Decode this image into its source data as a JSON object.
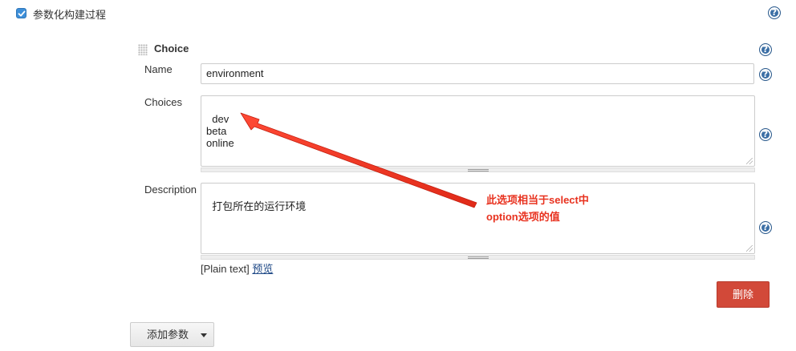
{
  "header": {
    "checkbox_checked": true,
    "checkbox_label": "参数化构建过程"
  },
  "parameter": {
    "title": "Choice",
    "name_label": "Name",
    "name_value": "environment",
    "choices_label": "Choices",
    "choices_value": "dev\nbeta\nonline",
    "description_label": "Description",
    "description_value": "打包所在的运行环境",
    "plain_text_label": "[Plain text]",
    "preview_link": "预览",
    "delete_button": "删除"
  },
  "add_param_button": "添加参数",
  "annotation": {
    "line1": "此选项相当于select中",
    "line2": "option选项的值",
    "color": "#e8321f"
  },
  "icons": [
    "help-icon",
    "drag-handle-icon",
    "chevron-down-icon",
    "resize-grip-icon",
    "arrow-icon"
  ],
  "colors": {
    "checkbox": "#3d8fd9",
    "help_icon": "#3a6ea5",
    "delete_button": "#d24939",
    "link": "#204a87"
  }
}
